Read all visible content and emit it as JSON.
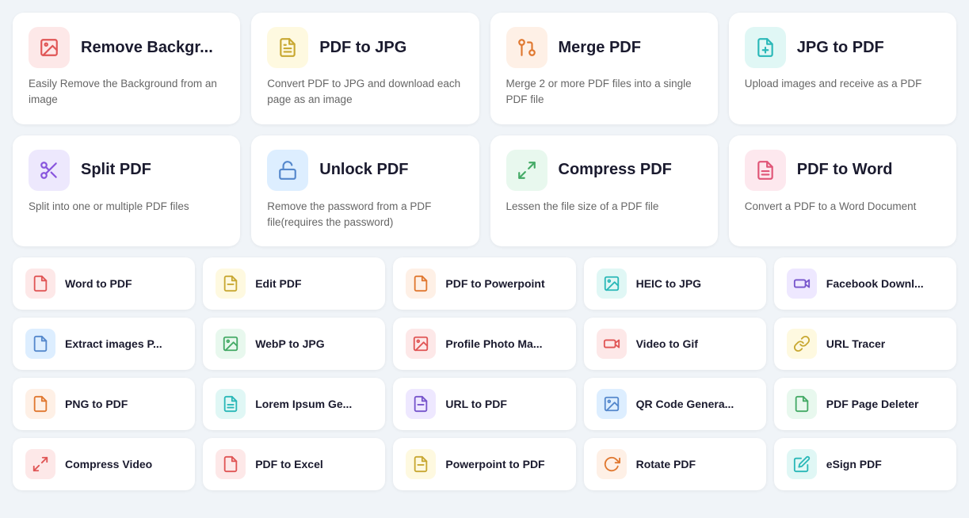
{
  "topRow": [
    {
      "id": "remove-background",
      "title": "Remove Backgr...",
      "desc": "Easily Remove the Background from an image",
      "iconColor": "#e05555",
      "iconBg": "#fde8e8",
      "iconType": "image"
    },
    {
      "id": "pdf-to-jpg",
      "title": "PDF to JPG",
      "desc": "Convert PDF to JPG and download each page as an image",
      "iconColor": "#c8a832",
      "iconBg": "#fef9e0",
      "iconType": "pdf"
    },
    {
      "id": "merge-pdf",
      "title": "Merge PDF",
      "desc": "Merge 2 or more PDF files into a single PDF file",
      "iconColor": "#e07830",
      "iconBg": "#fef0e6",
      "iconType": "merge"
    },
    {
      "id": "jpg-to-pdf",
      "title": "JPG to PDF",
      "desc": "Upload images and receive as a PDF",
      "iconColor": "#2ab8b8",
      "iconBg": "#e0f7f5",
      "iconType": "pdf-doc"
    }
  ],
  "midRow": [
    {
      "id": "split-pdf",
      "title": "Split PDF",
      "desc": "Split into one or multiple PDF files",
      "iconColor": "#8855dd",
      "iconBg": "#ede8fd",
      "iconType": "scissors"
    },
    {
      "id": "unlock-pdf",
      "title": "Unlock PDF",
      "desc": "Remove the password from a PDF file(requires the password)",
      "iconColor": "#5588cc",
      "iconBg": "#ddeeff",
      "iconType": "lock"
    },
    {
      "id": "compress-pdf",
      "title": "Compress PDF",
      "desc": "Lessen the file size of a PDF file",
      "iconColor": "#44aa66",
      "iconBg": "#e8f8ee",
      "iconType": "compress"
    },
    {
      "id": "pdf-to-word",
      "title": "PDF to Word",
      "desc": "Convert a PDF to a Word Document",
      "iconColor": "#e05577",
      "iconBg": "#fde8ee",
      "iconType": "pdf-word"
    }
  ],
  "smallRows": [
    [
      {
        "id": "word-to-pdf",
        "title": "Word to PDF",
        "iconColor": "#e05555",
        "iconBg": "#fde8e8",
        "iconType": "pdf-red"
      },
      {
        "id": "edit-pdf",
        "title": "Edit PDF",
        "iconColor": "#c8a832",
        "iconBg": "#fef9e0",
        "iconType": "pdf-yellow"
      },
      {
        "id": "pdf-to-powerpoint",
        "title": "PDF to Powerpoint",
        "iconColor": "#e07830",
        "iconBg": "#fef0e6",
        "iconType": "pdf-orange"
      },
      {
        "id": "heic-to-jpg",
        "title": "HEIC to JPG",
        "iconColor": "#2ab8b8",
        "iconBg": "#e0f7f5",
        "iconType": "image-teal"
      },
      {
        "id": "facebook-downl",
        "title": "Facebook Downl...",
        "iconColor": "#7755cc",
        "iconBg": "#eee8ff",
        "iconType": "video-purple"
      }
    ],
    [
      {
        "id": "extract-images",
        "title": "Extract images P...",
        "iconColor": "#5588cc",
        "iconBg": "#ddeeff",
        "iconType": "doc-blue"
      },
      {
        "id": "webp-to-jpg",
        "title": "WebP to JPG",
        "iconColor": "#44aa66",
        "iconBg": "#e8f8ee",
        "iconType": "image-green"
      },
      {
        "id": "profile-photo-ma",
        "title": "Profile Photo Ma...",
        "iconColor": "#e05555",
        "iconBg": "#fde8e8",
        "iconType": "image-red"
      },
      {
        "id": "video-to-gif",
        "title": "Video to Gif",
        "iconColor": "#e05555",
        "iconBg": "#fde8e8",
        "iconType": "video-red"
      },
      {
        "id": "url-tracer",
        "title": "URL Tracer",
        "iconColor": "#c8a832",
        "iconBg": "#fef9e0",
        "iconType": "link-yellow"
      }
    ],
    [
      {
        "id": "png-to-pdf",
        "title": "PNG to PDF",
        "iconColor": "#e07830",
        "iconBg": "#fef0e6",
        "iconType": "pdf-orange2"
      },
      {
        "id": "lorem-ipsum",
        "title": "Lorem Ipsum Ge...",
        "iconColor": "#2ab8b8",
        "iconBg": "#e0f7f5",
        "iconType": "doc-teal"
      },
      {
        "id": "url-to-pdf",
        "title": "URL to PDF",
        "iconColor": "#7755cc",
        "iconBg": "#eee8ff",
        "iconType": "doc-purple"
      },
      {
        "id": "qr-code",
        "title": "QR Code Genera...",
        "iconColor": "#5588cc",
        "iconBg": "#ddeeff",
        "iconType": "image-blue"
      },
      {
        "id": "pdf-page-deleter",
        "title": "PDF Page Deleter",
        "iconColor": "#44aa66",
        "iconBg": "#e8f8ee",
        "iconType": "doc-green"
      }
    ],
    [
      {
        "id": "compress-video",
        "title": "Compress Video",
        "iconColor": "#e05555",
        "iconBg": "#fde8e8",
        "iconType": "compress-red"
      },
      {
        "id": "pdf-to-excel",
        "title": "PDF to Excel",
        "iconColor": "#e05555",
        "iconBg": "#fde8e8",
        "iconType": "pdf-red2"
      },
      {
        "id": "powerpoint-to-pdf",
        "title": "Powerpoint to PDF",
        "iconColor": "#c8a832",
        "iconBg": "#fef9e0",
        "iconType": "doc-yellow"
      },
      {
        "id": "rotate-pdf",
        "title": "Rotate PDF",
        "iconColor": "#e07830",
        "iconBg": "#fef0e6",
        "iconType": "rotate-orange"
      },
      {
        "id": "esign-pdf",
        "title": "eSign PDF",
        "iconColor": "#2ab8b8",
        "iconBg": "#e0f7f5",
        "iconType": "edit-teal"
      }
    ]
  ]
}
